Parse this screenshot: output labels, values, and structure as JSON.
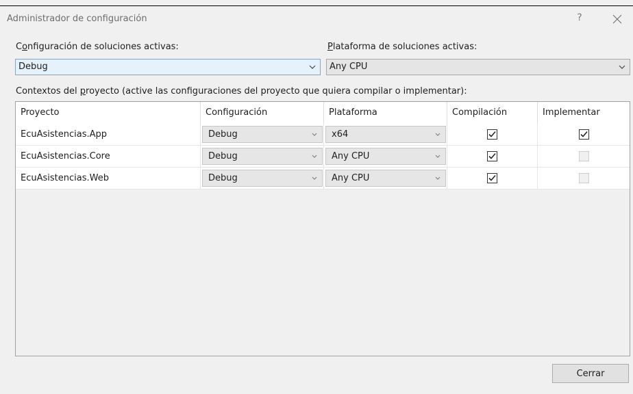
{
  "dialog": {
    "title": "Administrador de configuración",
    "help_glyph": "?"
  },
  "active_config": {
    "label_prefix": "C",
    "label_mnemonic": "o",
    "label_rest": "nfiguración de soluciones activas:",
    "value": "Debug"
  },
  "active_platform": {
    "label_mnemonic": "P",
    "label_rest": "lataforma de soluciones activas:",
    "value": "Any CPU"
  },
  "contexts": {
    "label_prefix": "Contextos del ",
    "label_mnemonic": "p",
    "label_rest": "royecto (active las configuraciones del proyecto que quiera compilar o implementar):"
  },
  "grid": {
    "headers": {
      "project": "Proyecto",
      "configuration": "Configuración",
      "platform": "Plataforma",
      "build": "Compilación",
      "deploy": "Implementar"
    },
    "rows": [
      {
        "project": "EcuAsistencias.App",
        "configuration": "Debug",
        "platform": "x64",
        "build": true,
        "deploy": true,
        "deploy_enabled": true
      },
      {
        "project": "EcuAsistencias.Core",
        "configuration": "Debug",
        "platform": "Any CPU",
        "build": true,
        "deploy": false,
        "deploy_enabled": false
      },
      {
        "project": "EcuAsistencias.Web",
        "configuration": "Debug",
        "platform": "Any CPU",
        "build": true,
        "deploy": false,
        "deploy_enabled": false
      }
    ]
  },
  "buttons": {
    "close_label": "Cerrar"
  },
  "icons": {
    "close": "close-icon",
    "help": "help-icon",
    "dropdown": "chevron-down-icon",
    "check": "checkmark-icon"
  },
  "colors": {
    "background": "#f0f0f0",
    "selected_dropdown": "#e5f1fb",
    "grid_bg": "#ffffff"
  }
}
